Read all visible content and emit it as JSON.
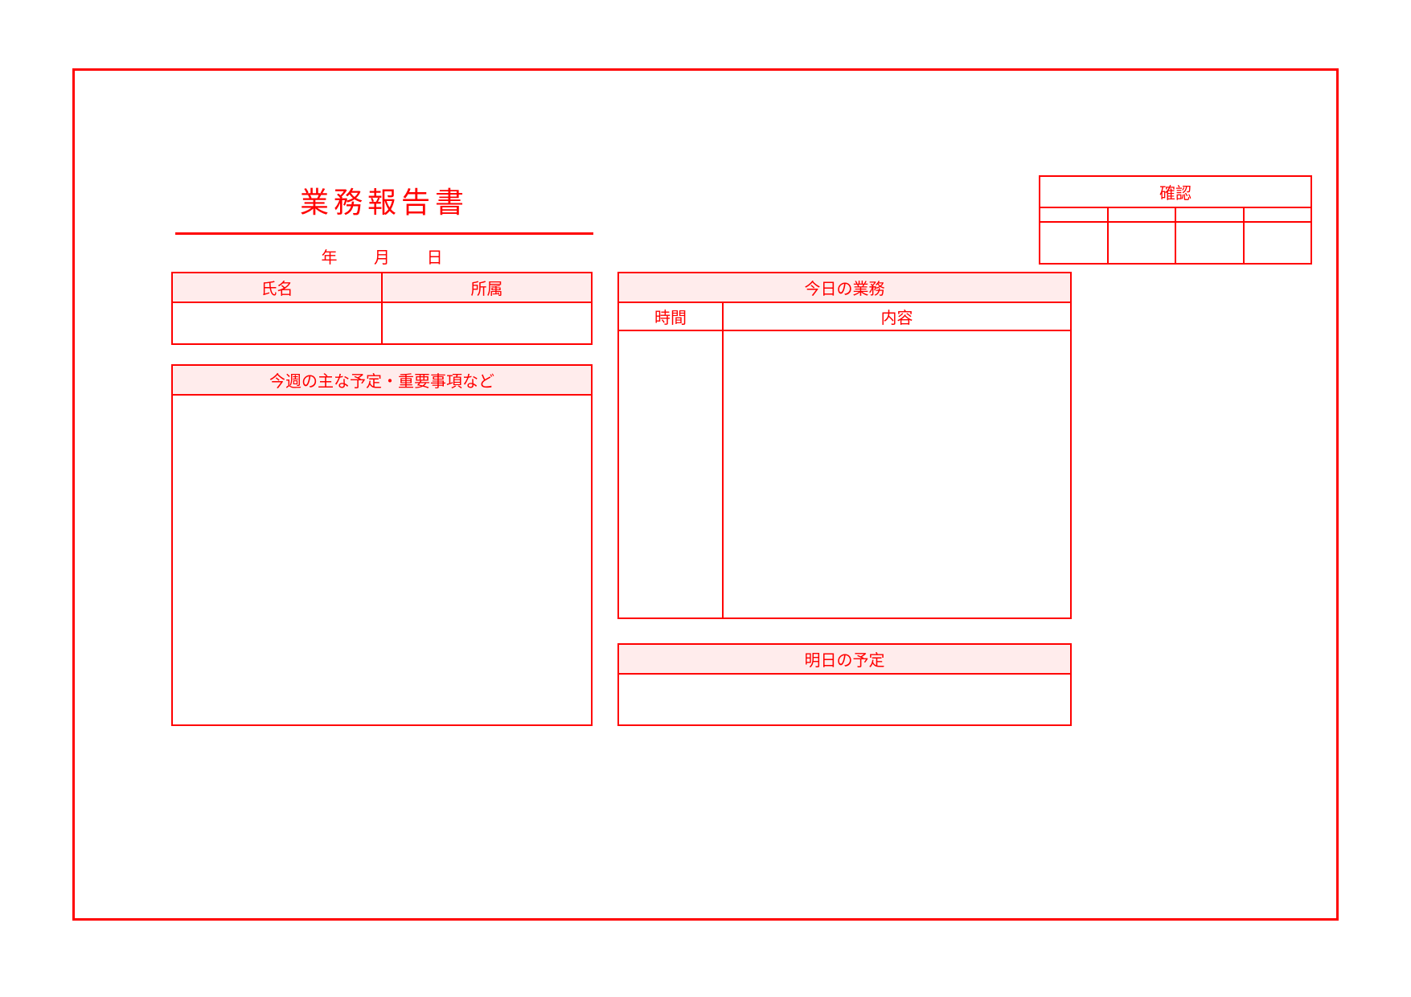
{
  "title": "業務報告書",
  "date": {
    "year_label": "年",
    "month_label": "月",
    "day_label": "日"
  },
  "approval": {
    "header": "確認"
  },
  "name_table": {
    "name_label": "氏名",
    "affiliation_label": "所属"
  },
  "week_schedule": {
    "header": "今週の主な予定・重要事項など"
  },
  "today": {
    "header": "今日の業務",
    "time_label": "時間",
    "content_label": "内容"
  },
  "tomorrow": {
    "header": "明日の予定"
  }
}
